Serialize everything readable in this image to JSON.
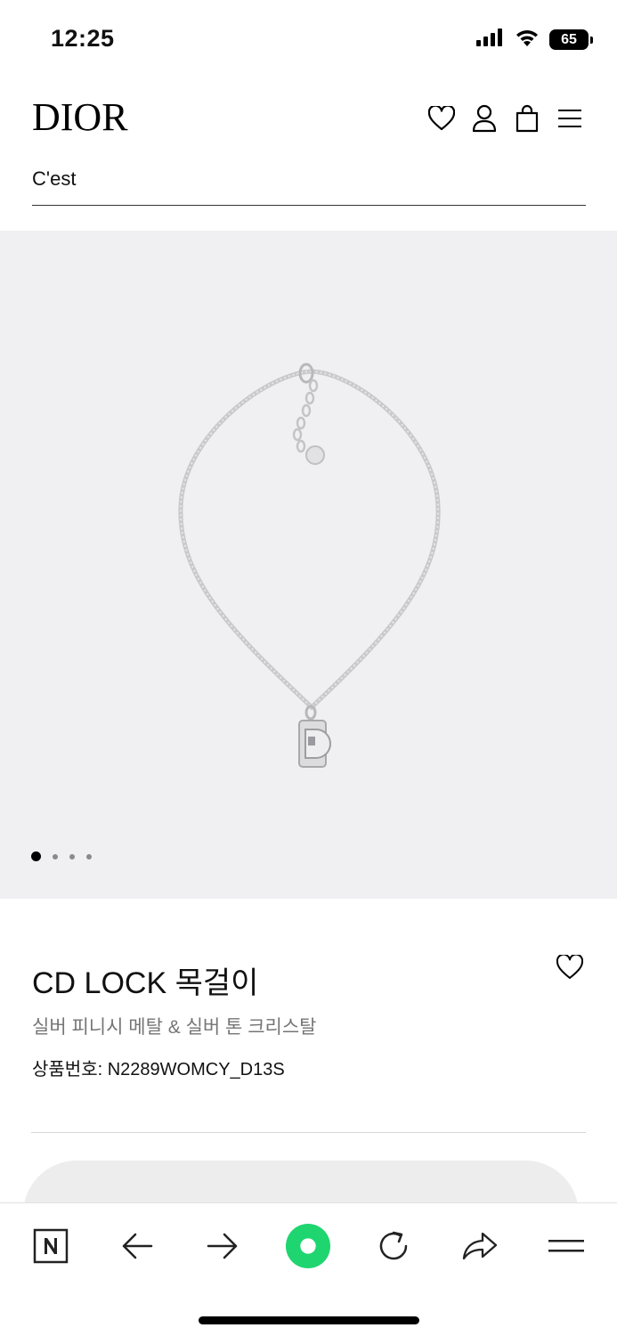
{
  "status_bar": {
    "time": "12:25",
    "battery": "65",
    "icons": [
      "signal-icon",
      "wifi-icon",
      "battery-icon"
    ]
  },
  "header": {
    "logo": "DIOR",
    "icons": [
      "heart-icon",
      "user-icon",
      "bag-icon",
      "menu-icon"
    ]
  },
  "search": {
    "value": "C'est"
  },
  "gallery": {
    "image": "necklace-image",
    "slide_count": 4,
    "active_slide": 1
  },
  "product": {
    "title": "CD LOCK 목걸이",
    "subtitle": "실버 피니시 메탈 & 실버 톤 크리스탈",
    "sku_label": "상품번호:",
    "sku_value": "N2289WOMCY_D13S"
  },
  "toolbar": {
    "items": [
      "naver-icon",
      "back-arrow-icon",
      "forward-arrow-icon",
      "green-dot-icon",
      "reload-icon",
      "share-icon",
      "menu-icon"
    ],
    "accent_color": "#1fd56f"
  }
}
